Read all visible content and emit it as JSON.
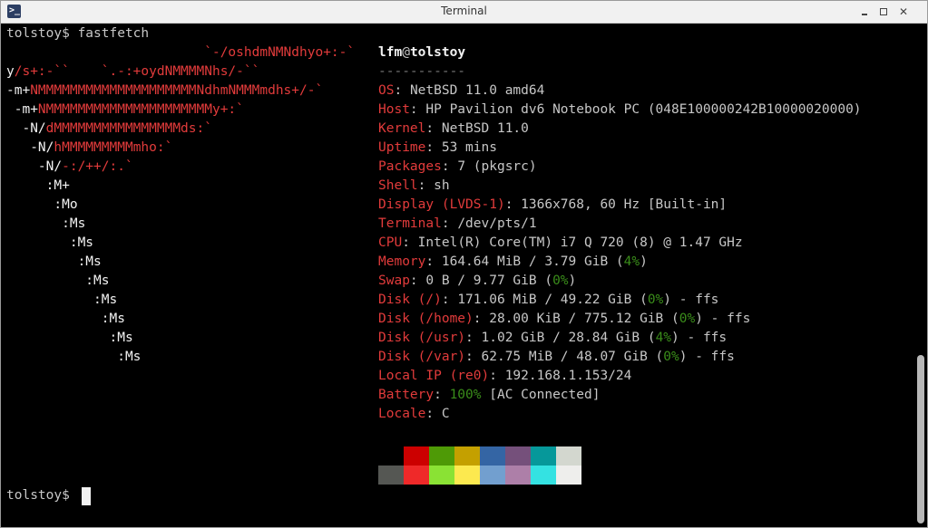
{
  "window": {
    "title": "Terminal",
    "app_icon_glyph": ">_"
  },
  "prompt": {
    "line1": "tolstoy$ fastfetch",
    "line2": "tolstoy$ "
  },
  "logo": [
    {
      "w": "",
      "r": "                         `-/oshdmNMNdhyo+:-`"
    },
    {
      "w": "y",
      "r": "/s+:-``    `.-:+oydNMMMMNhs/-``"
    },
    {
      "w": "-m+",
      "r": "NMMMMMMMMMMMMMMMMMMMMNdhmNMMMmdhs+/-`"
    },
    {
      "w": " -m+",
      "r": "NMMMMMMMMMMMMMMMMMMMMMy+:`"
    },
    {
      "w": "  -N/",
      "r": "dMMMMMMMMMMMMMMMMds:`"
    },
    {
      "w": "   -N/",
      "r": "hMMMMMMMMMmho:`"
    },
    {
      "w": "    -N/",
      "r": "-:/++/:.`"
    },
    {
      "w": "     :M+",
      "r": ""
    },
    {
      "w": "      :Mo",
      "r": ""
    },
    {
      "w": "       :Ms",
      "r": ""
    },
    {
      "w": "        :Ms",
      "r": ""
    },
    {
      "w": "         :Ms",
      "r": ""
    },
    {
      "w": "          :Ms",
      "r": ""
    },
    {
      "w": "           :Ms",
      "r": ""
    },
    {
      "w": "            :Ms",
      "r": ""
    },
    {
      "w": "             :Ms",
      "r": ""
    },
    {
      "w": "              :Ms",
      "r": ""
    }
  ],
  "header": {
    "user": "lfm",
    "at": "@",
    "host": "tolstoy",
    "separator": "-----------"
  },
  "info": [
    {
      "key": "OS",
      "parts": [
        {
          "t": "NetBSD 11.0 amd64"
        }
      ]
    },
    {
      "key": "Host",
      "parts": [
        {
          "t": "HP Pavilion dv6 Notebook PC (048E100000242B10000020000)"
        }
      ]
    },
    {
      "key": "Kernel",
      "parts": [
        {
          "t": "NetBSD 11.0"
        }
      ]
    },
    {
      "key": "Uptime",
      "parts": [
        {
          "t": "53 mins"
        }
      ]
    },
    {
      "key": "Packages",
      "parts": [
        {
          "t": "7 (pkgsrc)"
        }
      ]
    },
    {
      "key": "Shell",
      "parts": [
        {
          "t": "sh"
        }
      ]
    },
    {
      "key": "Display (LVDS-1)",
      "parts": [
        {
          "t": "1366x768, 60 Hz [Built-in]"
        }
      ]
    },
    {
      "key": "Terminal",
      "parts": [
        {
          "t": "/dev/pts/1"
        }
      ]
    },
    {
      "key": "CPU",
      "parts": [
        {
          "t": "Intel(R) Core(TM) i7 Q 720 (8) @ 1.47 GHz"
        }
      ]
    },
    {
      "key": "Memory",
      "parts": [
        {
          "t": "164.64 MiB / 3.79 GiB ("
        },
        {
          "t": "4%",
          "g": true
        },
        {
          "t": ")"
        }
      ]
    },
    {
      "key": "Swap",
      "parts": [
        {
          "t": "0 B / 9.77 GiB ("
        },
        {
          "t": "0%",
          "g": true
        },
        {
          "t": ")"
        }
      ]
    },
    {
      "key": "Disk (/)",
      "parts": [
        {
          "t": "171.06 MiB / 49.22 GiB ("
        },
        {
          "t": "0%",
          "g": true
        },
        {
          "t": ") - ffs"
        }
      ]
    },
    {
      "key": "Disk (/home)",
      "parts": [
        {
          "t": "28.00 KiB / 775.12 GiB ("
        },
        {
          "t": "0%",
          "g": true
        },
        {
          "t": ") - ffs"
        }
      ]
    },
    {
      "key": "Disk (/usr)",
      "parts": [
        {
          "t": "1.02 GiB / 28.84 GiB ("
        },
        {
          "t": "4%",
          "g": true
        },
        {
          "t": ") - ffs"
        }
      ]
    },
    {
      "key": "Disk (/var)",
      "parts": [
        {
          "t": "62.75 MiB / 48.07 GiB ("
        },
        {
          "t": "0%",
          "g": true
        },
        {
          "t": ") - ffs"
        }
      ]
    },
    {
      "key": "Local IP (re0)",
      "parts": [
        {
          "t": "192.168.1.153/24"
        }
      ]
    },
    {
      "key": "Battery",
      "parts": [
        {
          "t": "100%",
          "g": true
        },
        {
          "t": " [AC Connected]"
        }
      ]
    },
    {
      "key": "Locale",
      "parts": [
        {
          "t": "C"
        }
      ]
    }
  ],
  "palette": {
    "normal": [
      "#000000",
      "#cc0000",
      "#4e9a06",
      "#c4a000",
      "#3465a4",
      "#75507b",
      "#06989a",
      "#d3d7cf"
    ],
    "bright": [
      "#555753",
      "#ef2929",
      "#8ae234",
      "#fce94f",
      "#729fcf",
      "#ad7fa8",
      "#34e2e2",
      "#eeeeec"
    ]
  }
}
